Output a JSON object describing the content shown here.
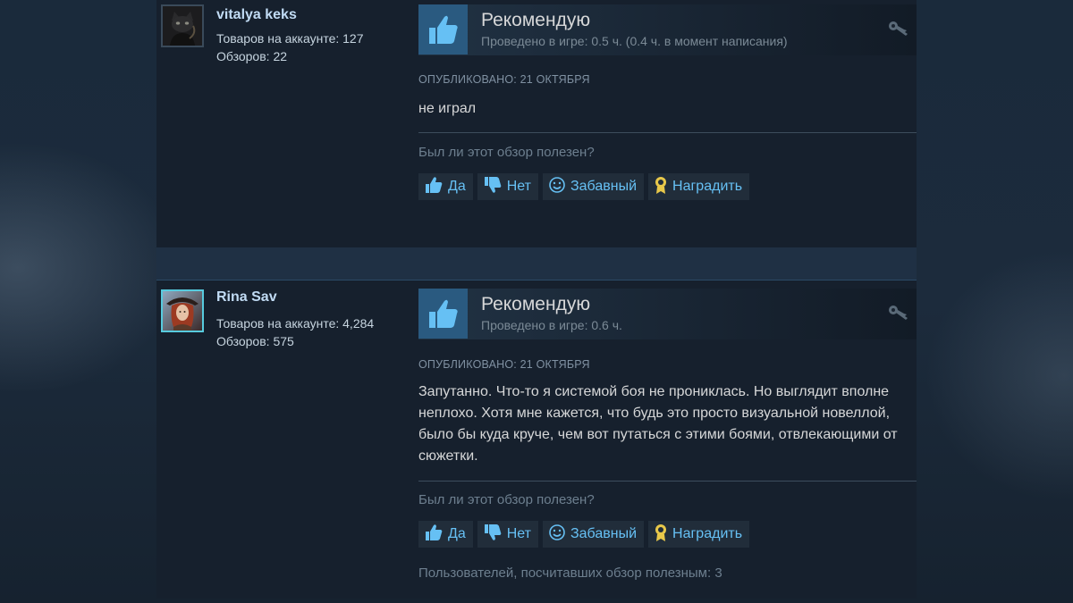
{
  "reviews": [
    {
      "persona_name": "vitalya keks",
      "products_label": "Товаров на аккаунте: 127",
      "reviews_label": "Обзоров: 22",
      "vote_title": "Рекомендую",
      "playtime": "Проведено в игре: 0.5 ч. (0.4 ч. в момент написания)",
      "posted": "ОПУБЛИКОВАНО: 21 ОКТЯБРЯ",
      "content": "не играл",
      "helpful_question": "Был ли этот обзор полезен?",
      "found_helpful": ""
    },
    {
      "persona_name": "Rina Sav",
      "products_label": "Товаров на аккаунте: 4,284",
      "reviews_label": "Обзоров: 575",
      "vote_title": "Рекомендую",
      "playtime": "Проведено в игре: 0.6 ч.",
      "posted": "ОПУБЛИКОВАНО: 21 ОКТЯБРЯ",
      "content": "Запутанно. Что-то я системой боя не прониклась. Но выглядит вполне неплохо. Хотя мне кажется, что будь это просто визуальной новеллой, было бы куда круче, чем вот путаться с этими боями, отвлекающими от сюжетки.",
      "helpful_question": "Был ли этот обзор полезен?",
      "found_helpful": "Пользователей, посчитавших обзор полезным: 3"
    }
  ],
  "buttons": {
    "yes": "Да",
    "no": "Нет",
    "funny": "Забавный",
    "award": "Наградить"
  },
  "icons": {
    "vote": "thumbs-up-icon",
    "key": "key-icon",
    "yes": "thumbs-up-icon",
    "no": "thumbs-down-icon",
    "funny": "smiley-icon",
    "award": "award-icon"
  },
  "colors": {
    "background": "#1b2838",
    "review_background": "#16202d",
    "link_blue": "#66c0f4",
    "persona_name": "#c1dbf4",
    "thumb_box": "#2a5a80"
  }
}
